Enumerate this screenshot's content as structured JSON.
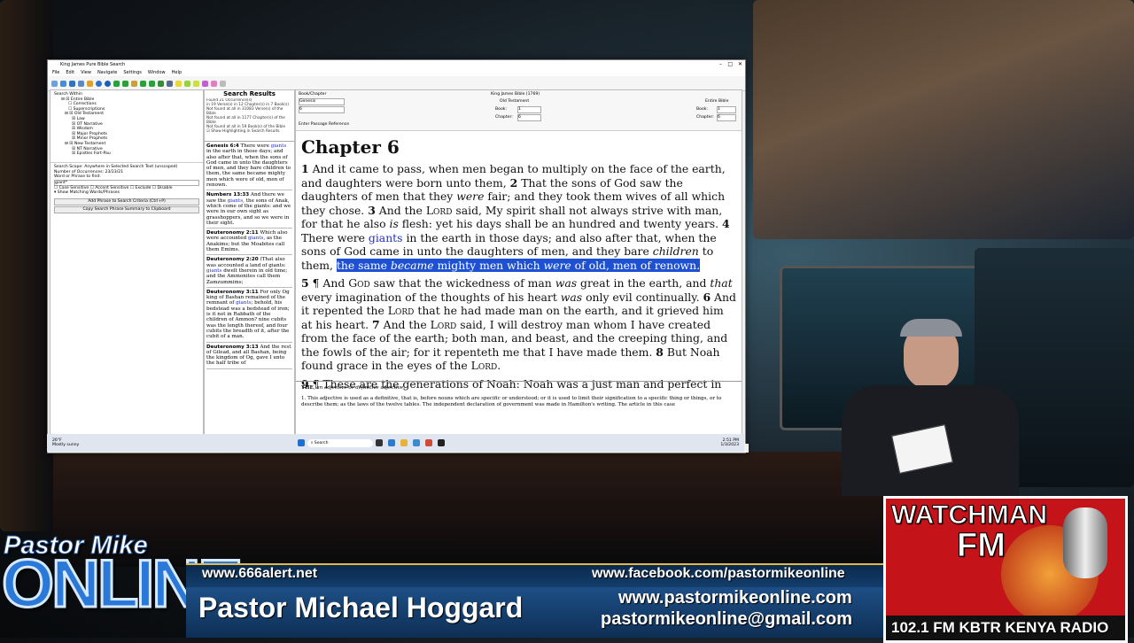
{
  "window": {
    "title": "King James Pure Bible Search",
    "menu": [
      "File",
      "Edit",
      "View",
      "Navigate",
      "Settings",
      "Window",
      "Help"
    ]
  },
  "left_panel": {
    "header": "Search Within",
    "tree": [
      "Entire Bible",
      "Corrections",
      "Superscriptions",
      "Old Testament",
      "Law",
      "OT Narrative",
      "Wisdom",
      "Major Prophets",
      "Minor Prophets",
      "New Testament",
      "NT Narrative",
      "Epistles Fort-Pau"
    ],
    "scope": "Search Scope: Anywhere in Selected Search Text (unscoped)",
    "occurrences": "Number of Occurrences: 23/23/21",
    "word_label": "Word or Phrase to find:",
    "word_value": "giant*",
    "options": [
      "Case Sensitive",
      "Accent Sensitive",
      "Exclude",
      "Disable"
    ],
    "show_matching": "Show Matching Words/Phrases",
    "add_button": "Add Phrase to Search Criteria (Ctrl+P)",
    "copy_button": "Copy Search Phrase Summary to Clipboard"
  },
  "results": {
    "title": "Search Results",
    "info": [
      "Found 21 Occurrence(s)",
      "in 19 Verse(s) in 12 Chapter(s) in 7 Book(s)",
      "Not found at all in 31083 Verse(s) of the Bible",
      "Not found at all in 1177 Chapter(s) of the Bible",
      "Not found at all in 59 Book(s) of the Bible"
    ],
    "highlight_label": "Show Highlighting in Search Results",
    "items": [
      {
        "ref": "Genesis 6:4",
        "pre": "There were ",
        "hit": "giants",
        "post": " in the earth in those days; and also after that, when the sons of God came in unto the daughters of men, and they bare children to them, the same became mighty men which were of old, men of renown."
      },
      {
        "ref": "Numbers 13:33",
        "pre": "And there we saw the ",
        "hit": "giants",
        "post": ", the sons of Anak, which come of the giants: and we were in our own sight as grasshoppers, and so we were in their sight."
      },
      {
        "ref": "Deuteronomy 2:11",
        "pre": "Which also were accounted ",
        "hit": "giants",
        "post": ", as the Anakims; but the Moabites call them Emims."
      },
      {
        "ref": "Deuteronomy 2:20",
        "pre": "(That also was accounted a land of giants: ",
        "hit": "giants",
        "post": " dwelt therein in old time; and the Ammonites call them Zamzummims;"
      },
      {
        "ref": "Deuteronomy 3:11",
        "pre": "For only Og king of Bashan remained of the remnant of ",
        "hit": "giants",
        "post": "; behold, his bedstead was a bedstead of iron; is it not in Rabbath of the children of Ammon? nine cubits was the length thereof, and four cubits the breadth of it, after the cubit of a man."
      },
      {
        "ref": "Deuteronomy 3:13",
        "pre": "And the rest of Gilead, and all Bashan, being the kingdom of Og, gave I unto the half tribe of",
        "hit": "",
        "post": ""
      }
    ]
  },
  "nav": {
    "book_chapter": "Book/Chapter",
    "book": "Genesis",
    "chapter": "6",
    "version": "King James Bible (1769)",
    "ot": "Old Testament",
    "entire": "Entire Bible",
    "book_label": "Book:",
    "chapter_label": "Chapter:",
    "book_val": "1",
    "chapter_val": "6",
    "entire_book": "1",
    "entire_chapter": "6",
    "enter_ref": "Enter Passage Reference"
  },
  "bible": {
    "chapter_title": "Chapter 6",
    "v1": "And it came to pass, when men began to multiply on the face of the earth, and daughters were born unto them,",
    "v2": "That the sons of God saw the daughters of men that they ",
    "v2_it": "were",
    "v2b": " fair; and they took them wives of all which they chose.",
    "v3a": "And the ",
    "lord": "Lord",
    "v3b": " said, My spirit shall not always strive with man, for that he also ",
    "v3_it": "is",
    "v3c": " flesh: yet his days shall be an hundred and twenty years.",
    "v4a": "There were ",
    "giants": "giants",
    "v4b": " in the earth in those days; and also after that, when the sons of God came in unto the daughters of men, and they bare ",
    "v4_it": "children",
    "v4c": " to them, ",
    "v4_sel1": "the same ",
    "v4_sel_it": "became",
    "v4_sel2": " mighty men which ",
    "v4_sel_it2": "were",
    "v4_sel3": " of old, men of renown.",
    "v5a": "¶ And ",
    "god": "God",
    "v5b": " saw that the wickedness of man ",
    "v5_it": "was",
    "v5c": " great in the earth, and ",
    "v5_it2": "that",
    "v5d": " every imagination of the thoughts of his heart ",
    "v5_it3": "was",
    "v5e": " only evil continually.",
    "v6a": "And it repented the ",
    "v6b": " that he had made man on the earth, and it grieved him at his heart.",
    "v7a": "And the ",
    "v7b": " said, I will destroy man whom I have created from the face of the earth; both man, and beast, and the creeping thing, and the fowls of the air; for it repenteth me that I have made them.",
    "v8a": "But Noah found grace in the eyes of the ",
    "v8b": ".",
    "v9": "¶ These are the generations of Noah: Noah was a just man and perfect in his"
  },
  "dictionary": {
    "term": "THE",
    "def": ", an adjective or definitive adjective.",
    "body": "1. This adjective is used as a definitive, that is, before nouns which are specific or understood; or it is used to limit their signification to a specific thing or things, or to describe them; as the laws of the twelve tables. The independent declaration of government was made in Hamilton's writing. The article in this case"
  },
  "status": "Genesis 6:4 (32) - Genesis 6:4 (43) : 12 Word(s) Selected",
  "taskbar": {
    "search": "Search",
    "weather": "Mostly sunny",
    "temp": "26°F",
    "time": "2:51 PM",
    "date": "1/3/2023"
  },
  "overlay": {
    "pastor": "Pastor Mike",
    "online": "ONLINE",
    "url1": "www.666alert.net",
    "fb": "www.facebook.com/pastormikeonline",
    "name": "Pastor Michael Hoggard",
    "url2": "www.pastormikeonline.com",
    "email": "pastormikeonline@gmail.com"
  },
  "watchman": {
    "line1": "WATCHMAN",
    "line2": "FM",
    "bottom": "102.1 FM  KBTR KENYA  RADIO"
  }
}
